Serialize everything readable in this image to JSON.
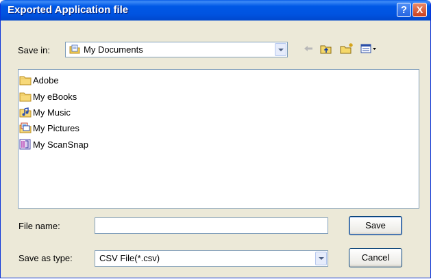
{
  "window": {
    "title": "Exported Application file"
  },
  "titlebar": {
    "help_glyph": "?",
    "close_glyph": "X"
  },
  "save_in": {
    "label": "Save in:",
    "value": "My Documents",
    "icon": "my-documents-icon"
  },
  "toolbar": {
    "icons": [
      "back-arrow-icon",
      "up-folder-icon",
      "new-folder-icon",
      "view-menu-icon"
    ]
  },
  "files": [
    {
      "name": "Adobe",
      "icon": "folder-icon"
    },
    {
      "name": "My eBooks",
      "icon": "folder-icon"
    },
    {
      "name": "My Music",
      "icon": "music-folder-icon"
    },
    {
      "name": "My Pictures",
      "icon": "pictures-folder-icon"
    },
    {
      "name": "My ScanSnap",
      "icon": "scansnap-folder-icon"
    }
  ],
  "file_name": {
    "label": "File name:",
    "value": ""
  },
  "save_as_type": {
    "label": "Save as type:",
    "value": "CSV File(*.csv)"
  },
  "buttons": {
    "save": "Save",
    "cancel": "Cancel"
  },
  "colors": {
    "title_bar": "#0054e3",
    "dialog_bg": "#ece9d8",
    "field_border": "#7f9db9"
  }
}
